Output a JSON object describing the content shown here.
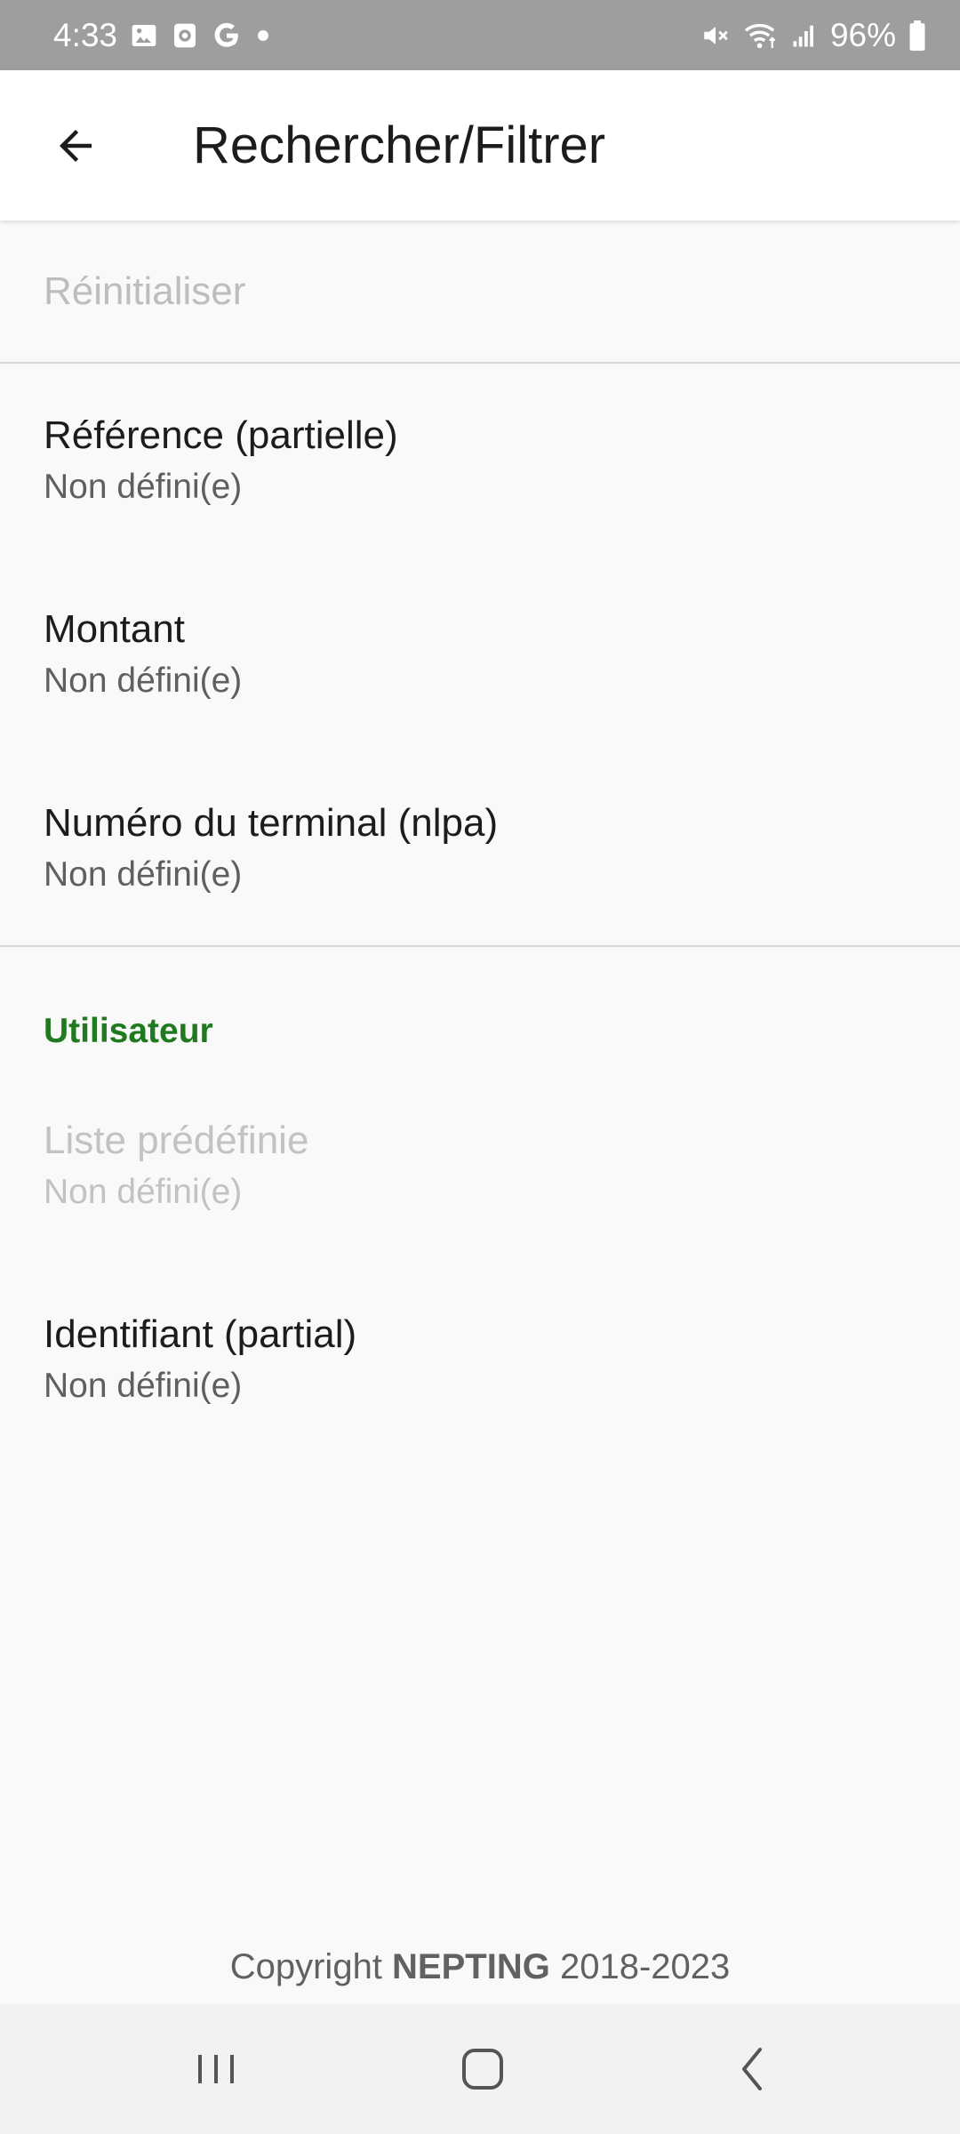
{
  "status_bar": {
    "time": "4:33",
    "battery": "96%",
    "icons": [
      "image-icon",
      "camera-app-icon",
      "google-icon",
      "dot-icon",
      "mute-icon",
      "wifi-icon",
      "signal-icon",
      "battery-icon"
    ]
  },
  "app_bar": {
    "title": "Rechercher/Filtrer",
    "back_icon": "arrow-back-icon"
  },
  "reset": {
    "label": "Réinitialiser"
  },
  "filters": [
    {
      "title": "Référence (partielle)",
      "summary": "Non défini(e)",
      "enabled": true
    },
    {
      "title": "Montant",
      "summary": "Non défini(e)",
      "enabled": true
    },
    {
      "title": "Numéro du terminal (nlpa)",
      "summary": "Non défini(e)",
      "enabled": true
    }
  ],
  "user_section": {
    "header": "Utilisateur",
    "items": [
      {
        "title": "Liste prédéfinie",
        "summary": "Non défini(e)",
        "enabled": false
      },
      {
        "title": "Identifiant (partial)",
        "summary": "Non défini(e)",
        "enabled": true
      }
    ]
  },
  "footer": {
    "prefix": "Copyright ",
    "brand": "NEPTING",
    "suffix": " 2018-2023"
  },
  "nav_bar": {
    "icons": [
      "recent-apps-icon",
      "home-icon",
      "back-nav-icon"
    ]
  },
  "colors": {
    "status_bar_bg": "#9e9e9e",
    "accent_green": "#1f7a1f",
    "disabled_text": "#bdbdbd"
  }
}
